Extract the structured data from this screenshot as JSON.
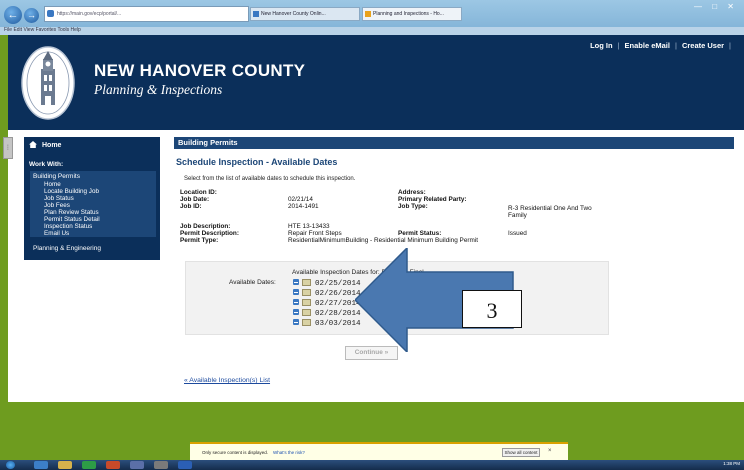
{
  "browser": {
    "address": "https://main.gov/ecp/portal/...",
    "tabs": [
      "New Hanover County Onlin...",
      "Planning and Inspections - Ho..."
    ],
    "menu": "File   Edit   View   Favorites   Tools   Help"
  },
  "header": {
    "title": "NEW HANOVER COUNTY",
    "subtitle": "Planning & Inspections",
    "links": [
      "Log In",
      "Enable eMail",
      "Create User"
    ]
  },
  "sidebar": {
    "home": "Home",
    "work_with": "Work With:",
    "section": "Building Permits",
    "items": [
      "Home",
      "Locate Building Job",
      "Job Status",
      "Job Fees",
      "Plan Review Status",
      "Permit Status Detail",
      "Inspection Status",
      "Email Us"
    ],
    "other": "Planning & Engineering"
  },
  "panel": {
    "header": "Building Permits",
    "title": "Schedule Inspection - Available Dates",
    "intro": "Select from the list of available dates to schedule this inspection.",
    "fields": {
      "location_id_label": "Location ID:",
      "job_date_label": "Job Date:",
      "job_date": "02/21/14",
      "job_id_label": "Job ID:",
      "job_id": "2014-1491",
      "address_label": "Address:",
      "primary_party_label": "Primary Related Party:",
      "job_type_label": "Job Type:",
      "job_type_line1": "R-3 Residential One And Two",
      "job_type_line2": "Family",
      "job_desc_label": "Job Description:",
      "job_desc": "HTE 13-13433",
      "permit_desc_label": "Permit Description:",
      "permit_desc": "Repair Front Steps",
      "permit_type_label": "Permit Type:",
      "permit_type": "ResidentialMinimumBuilding - Residential Minimum Building Permit",
      "permit_status_label": "Permit Status:",
      "permit_status": "Issued"
    },
    "dates_heading": "Available Inspection Dates for: Bldg Res Final",
    "dates_label": "Available Dates:",
    "dates": [
      "02/25/2014",
      "02/26/2014",
      "02/27/2014",
      "02/28/2014",
      "03/03/2014"
    ],
    "continue": "Continue »",
    "link": "« Available Inspection(s) List"
  },
  "annotation": {
    "number": "3",
    "arrow_color": "#4a78b0"
  },
  "notify": {
    "text": "Only secure content is displayed.",
    "link": "What's the risk?",
    "button": "Show all content",
    "close": "×"
  },
  "taskbar": {
    "clock": "1:38 PM"
  }
}
